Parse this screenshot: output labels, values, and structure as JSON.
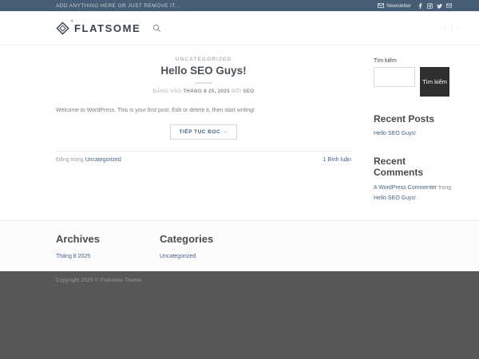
{
  "topbar": {
    "message": "ADD ANYTHING HERE OR JUST REMOVE IT...",
    "newsletter_label": "Newsletter"
  },
  "header": {
    "logo_text": "FLATSOME",
    "registered": "®"
  },
  "icons": {
    "prev": "‹",
    "next": "›"
  },
  "post": {
    "category": "UNCATEGORIZED",
    "title": "Hello SEO Guys!",
    "date_prefix": "ĐĂNG VÀO",
    "date": "THÁNG 8 25, 2025",
    "by_label": "BỞI",
    "author": "SEO",
    "excerpt": "Welcome to WordPress. This is your first post. Edit or delete it, then start writing!",
    "read_more_label": "TIẾP TỤC ĐỌC →",
    "posted_in_label": "Đăng trong",
    "posted_in_link": "Uncategorized",
    "comments_link": "1 Bình luận"
  },
  "sidebar": {
    "search_label": "Tìm kiếm",
    "search_button_label": "Tìm kiếm",
    "search_value": "",
    "recent_posts_title": "Recent Posts",
    "recent_posts": [
      "Hello SEO Guys!"
    ],
    "recent_comments_title": "Recent Comments",
    "recent_comment": {
      "author": "A WordPress Commenter",
      "connector": "trong",
      "post": "Hello SEO Guys!"
    }
  },
  "footer": {
    "archives_title": "Archives",
    "archives_links": [
      "Tháng 8 2025"
    ],
    "categories_title": "Categories",
    "categories_links": [
      "Uncategorized"
    ],
    "copyright": "Copyright 2025 © Flatsome Theme"
  },
  "colors": {
    "primary": "#446084",
    "topbar_bg": "#475d75",
    "search_button_bg": "#2f2f2f",
    "absolute_footer_bg": "#575757"
  }
}
